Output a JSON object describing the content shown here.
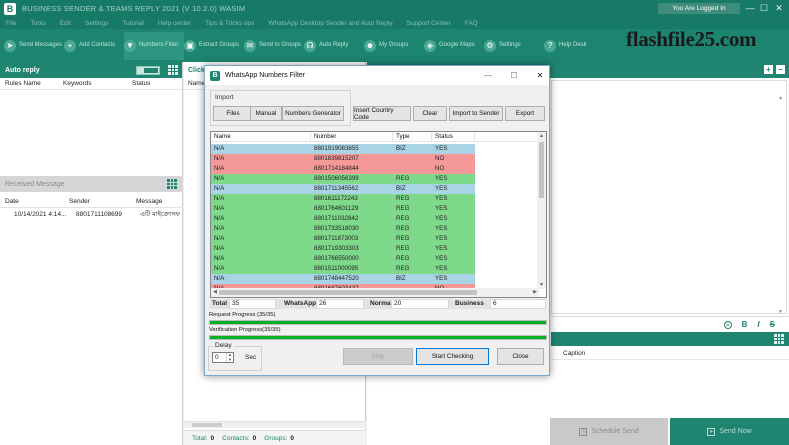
{
  "app": {
    "title": "BUSINESS SENDER & TEAMS REPLY 2021 (V 10.2.0) WASIM",
    "logo_letter": "B",
    "logged_in": "You Are Logged In"
  },
  "menu": [
    "File",
    "Tools",
    "Edit",
    "Settings",
    "Tutorial",
    "Help center",
    "Tips & Tricks ops",
    "WhatsApp Desktop Sender and Auto Reply",
    "Support Center",
    "FAQ"
  ],
  "toolbar": [
    {
      "label": "Send Messages",
      "icon": "send-icon"
    },
    {
      "label": "Add Contacts",
      "icon": "plus-icon"
    },
    {
      "label": "Numbers Filter",
      "icon": "filter-icon"
    },
    {
      "label": "Extract Groups",
      "icon": "group-icon"
    },
    {
      "label": "Send to Groups",
      "icon": "chat-icon"
    },
    {
      "label": "Auto Reply",
      "icon": "headset-icon"
    },
    {
      "label": "My Groups",
      "icon": "people-icon"
    },
    {
      "label": "Google Maps",
      "icon": "map-icon"
    },
    {
      "label": "Settings",
      "icon": "gear-icon"
    },
    {
      "label": "Help Desk",
      "icon": "help-icon"
    }
  ],
  "watermark": "flashfile25.com",
  "left_panel": {
    "title": "Auto reply",
    "columns": [
      "Rules Name",
      "Keywords",
      "Status"
    ],
    "received_title": "Received Message",
    "received_columns": [
      "Date",
      "Sender",
      "Message"
    ],
    "received_row": {
      "date": "10/14/2021 4:14...",
      "sender": "8801711108699",
      "message": "এটি মাইক্রোসফ"
    }
  },
  "middle_panel": {
    "title": "Click",
    "col": "Name",
    "total_label": "Total:",
    "total": "0",
    "contacts_label": "Contacts:",
    "contacts": "0",
    "groups_label": "Groups:",
    "groups": "0"
  },
  "right_panel": {
    "caption_col": "Caption",
    "schedule": "Schedule Send",
    "send_now": "Send Now"
  },
  "dialog": {
    "title": "WhatsApp Numbers Filter",
    "import_group": "Import",
    "buttons": {
      "files": "Files",
      "manual": "Manual",
      "generator": "Numbers Generator",
      "insert_country": "Insert Country Code",
      "clear": "Clear",
      "import_sender": "Import to Sender",
      "export": "Export",
      "stop": "Stop",
      "start": "Start Checking",
      "close": "Close"
    },
    "columns": [
      "Name",
      "Number",
      "Type",
      "Status"
    ],
    "row_colors": {
      "BIZ": "#a9d4e6",
      "REG": "#7ed98a",
      "NO": "#f59898"
    },
    "rows": [
      {
        "name": "N/A",
        "number": "8801919083855",
        "type": "BIZ",
        "status": "YES"
      },
      {
        "name": "N/A",
        "number": "8801839815207",
        "type": "",
        "status": "NO"
      },
      {
        "name": "N/A",
        "number": "8801714184844",
        "type": "",
        "status": "NO"
      },
      {
        "name": "N/A",
        "number": "8801506056399",
        "type": "REG",
        "status": "YES"
      },
      {
        "name": "N/A",
        "number": "8801711345562",
        "type": "BIZ",
        "status": "YES"
      },
      {
        "name": "N/A",
        "number": "8801611172243",
        "type": "REG",
        "status": "YES"
      },
      {
        "name": "N/A",
        "number": "8801764601129",
        "type": "REG",
        "status": "YES"
      },
      {
        "name": "N/A",
        "number": "8801711032842",
        "type": "REG",
        "status": "YES"
      },
      {
        "name": "N/A",
        "number": "8801733518030",
        "type": "REG",
        "status": "YES"
      },
      {
        "name": "N/A",
        "number": "8801711873003",
        "type": "REG",
        "status": "YES"
      },
      {
        "name": "N/A",
        "number": "8801719303303",
        "type": "REG",
        "status": "YES"
      },
      {
        "name": "N/A",
        "number": "8801766550000",
        "type": "REG",
        "status": "YES"
      },
      {
        "name": "N/A",
        "number": "8801511000095",
        "type": "REG",
        "status": "YES"
      },
      {
        "name": "N/A",
        "number": "8801748447520",
        "type": "BIZ",
        "status": "YES"
      },
      {
        "name": "N/A",
        "number": "8801687603437",
        "type": "",
        "status": "NO"
      },
      {
        "name": "N/A",
        "number": "8801616407879",
        "type": "",
        "status": "NO"
      }
    ],
    "stats": {
      "total_label": "Total",
      "total": "35",
      "whatsapp_label": "WhatsApp",
      "whatsapp": "26",
      "normal_label": "Normal",
      "normal": "20",
      "business_label": "Business",
      "business": "6"
    },
    "request_progress": "Request Progress (35/35)",
    "request_fraction": 1.0,
    "verification_progress": "Verification Progress(35/35)",
    "verification_fraction": 1.0,
    "delay_label": "Delay",
    "delay_value": "0",
    "sec_label": "Sec"
  }
}
